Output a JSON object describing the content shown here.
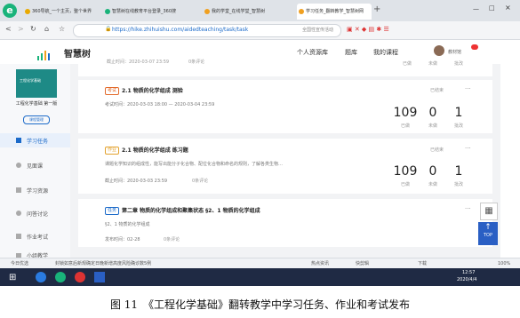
{
  "browser": {
    "tabs": [
      {
        "title": "360导航_一个主页，整个世界"
      },
      {
        "title": "智慧树在线教育平台登录_360搜"
      },
      {
        "title": "我的学堂_在线学堂_智慧树"
      },
      {
        "title": "学习任务_翻转教学_智慧树网"
      }
    ],
    "url": "https://hike.zhihuishu.com/aidedteaching/task/task",
    "search_hint": "全国性宣传活动",
    "window_controls": [
      "—",
      "□",
      "×"
    ]
  },
  "app": {
    "logo": "智慧树",
    "nav": [
      "个人资源库",
      "题库",
      "我的课程"
    ],
    "user": "教材馆"
  },
  "sidebar": {
    "course_title": "工程化学基础 第一版",
    "course_badge": "课程管理",
    "items": [
      {
        "label": "学习任务"
      },
      {
        "label": "见面课"
      },
      {
        "label": "学习资源"
      },
      {
        "label": "问答讨论"
      },
      {
        "label": "作业考试"
      },
      {
        "label": "小组教学"
      }
    ]
  },
  "tasks": [
    {
      "deadline": "截止时间：2020-03-07 23:59",
      "comments": "0条评论",
      "stats_labels": [
        "已做",
        "未做",
        "批改"
      ]
    },
    {
      "tag": "考试",
      "title": "2.1 物质的化学组成 测验",
      "time": "考试时间：2020-03-03 18:00 — 2020-03-04 23:59",
      "status": "已结束",
      "stats": [
        {
          "num": "109",
          "label": "已做"
        },
        {
          "num": "0",
          "label": "未做"
        },
        {
          "num": "1",
          "label": "批改"
        }
      ]
    },
    {
      "tag": "作业",
      "title": "2.1 物质的化学组成 练习题",
      "desc": "课题化学知识的组成性，能写出能分子化合物、配位化合物和命名的规则，了解各类生物…",
      "deadline": "截止时间：2020-03-03 23:59",
      "comments": "0条评论",
      "status": "已结束",
      "stats": [
        {
          "num": "109",
          "label": "已做"
        },
        {
          "num": "0",
          "label": "未做"
        },
        {
          "num": "1",
          "label": "批改"
        }
      ]
    },
    {
      "tag": "任务",
      "title": "第二章 物质的化学组成和聚集状态 §2、1 物质的化学组成",
      "sub": "§2、1 物质的化学组成",
      "publish": "发布时间：02-28",
      "comments": "0条评论"
    }
  ],
  "floating": {
    "top_label": "TOP"
  },
  "statusbar": {
    "left": "今日优选",
    "news": "封锁如意后新规确定日晚新增高度风险确诊数5例",
    "right_items": [
      "热点资讯",
      "快剪辑",
      "下载",
      "100%"
    ]
  },
  "taskbar": {
    "time": "12:57",
    "date": "2020/4/4"
  },
  "caption": "图 11　《工程化学基础》翻转教学中学习任务、作业和考试发布"
}
